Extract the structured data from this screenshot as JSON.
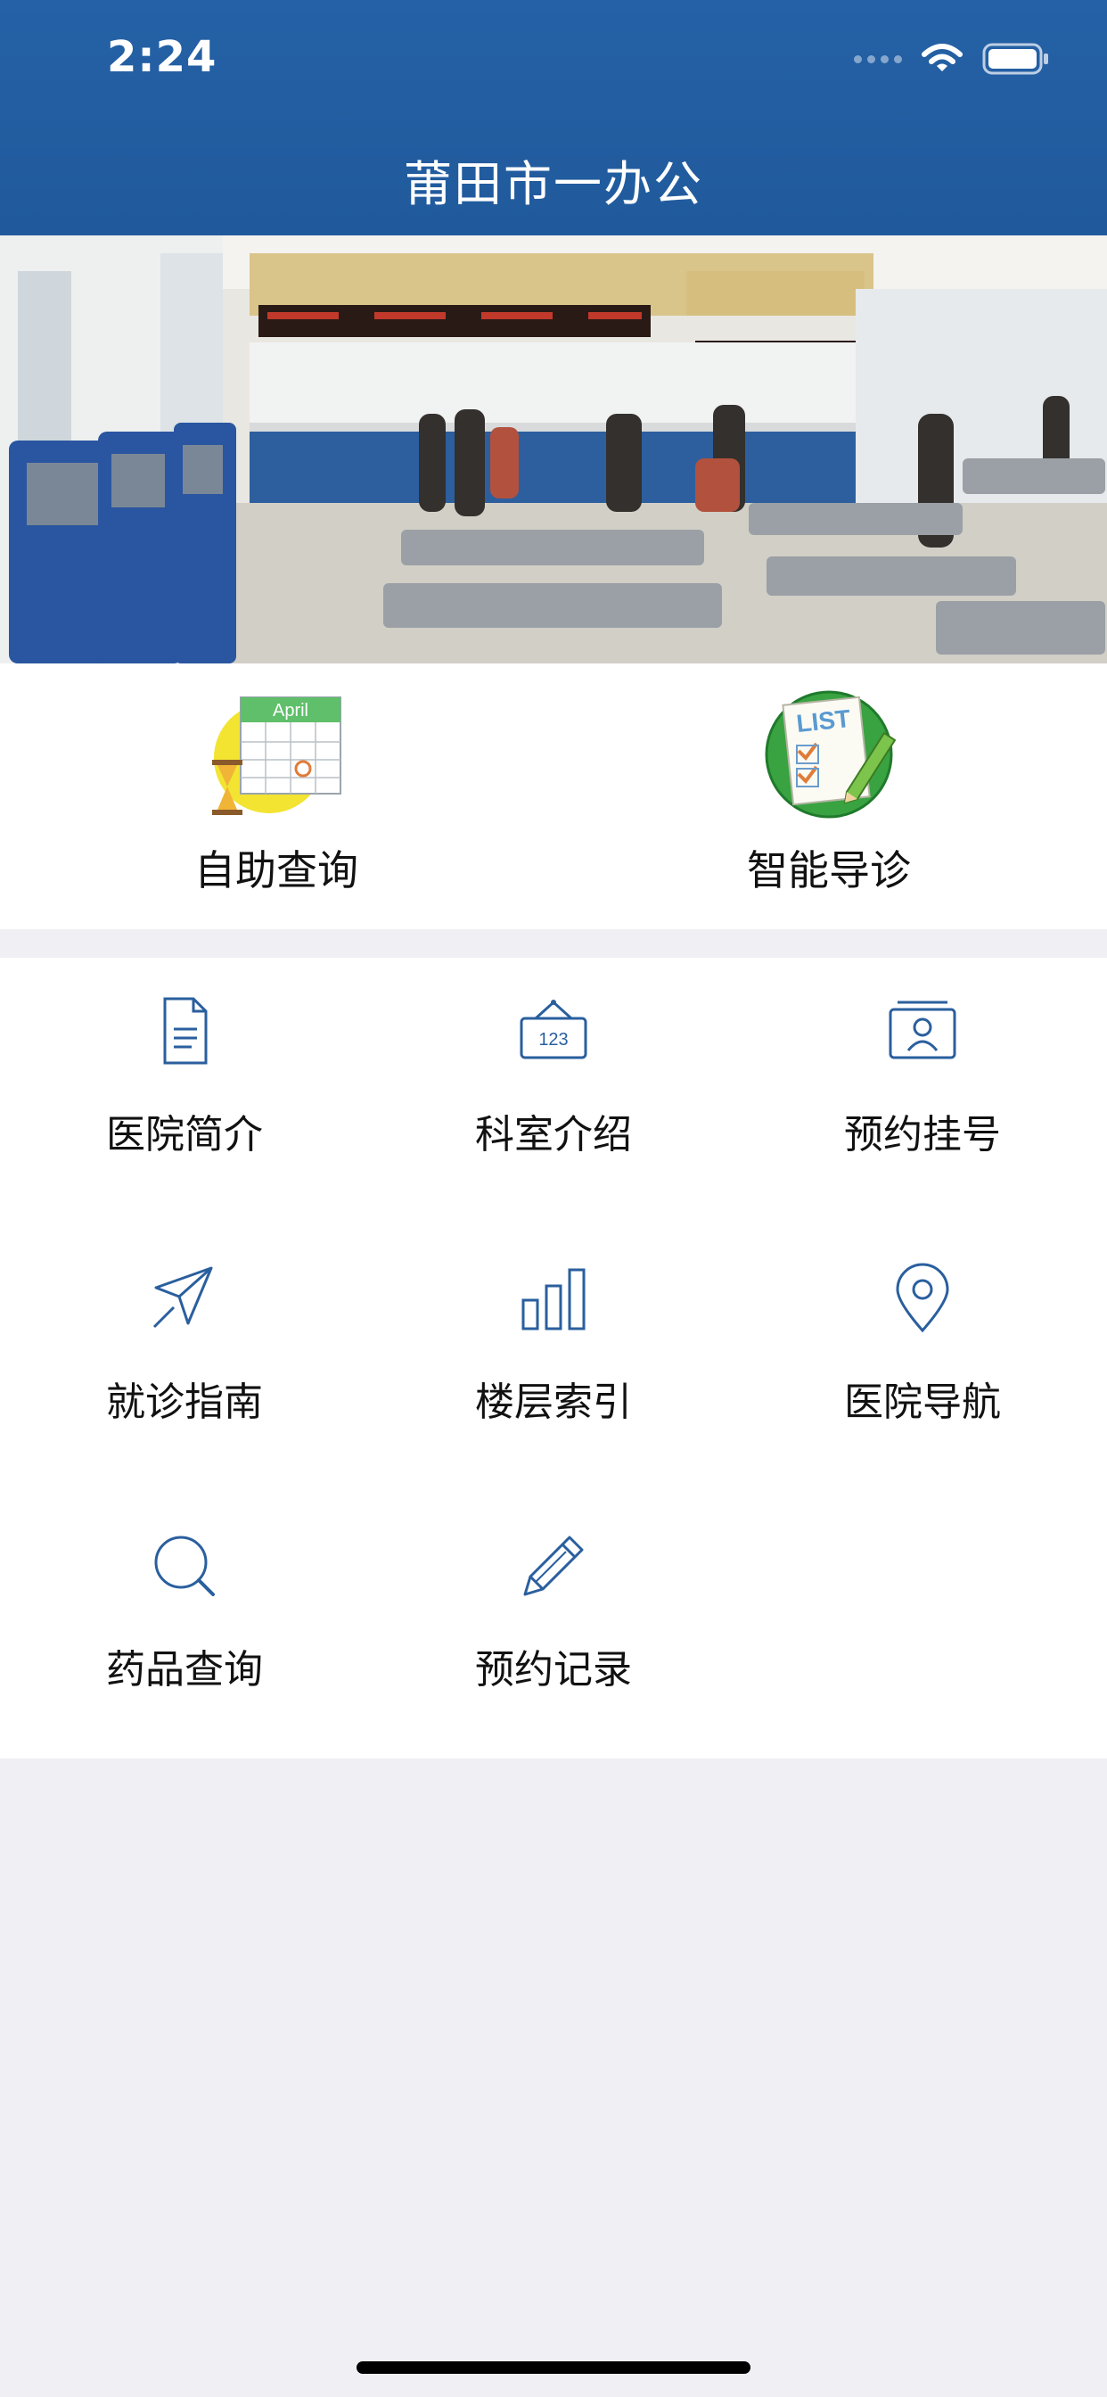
{
  "status_bar": {
    "time": "2:24",
    "wifi_icon": "wifi-icon",
    "battery_icon": "battery-icon"
  },
  "header": {
    "title": "莆田市一办公"
  },
  "banner": {
    "image": "hospital-lobby-photo"
  },
  "quick_actions": [
    {
      "label": "自助查询",
      "icon": "calendar-hourglass-icon",
      "calendar_month": "April"
    },
    {
      "label": "智能导诊",
      "icon": "checklist-icon",
      "badge_text": "LIST"
    }
  ],
  "grid_items": [
    {
      "label": "医院简介",
      "icon": "document-icon"
    },
    {
      "label": "科室介绍",
      "icon": "sign-board-icon",
      "icon_text": "123"
    },
    {
      "label": "预约挂号",
      "icon": "id-card-icon"
    },
    {
      "label": "就诊指南",
      "icon": "paper-plane-icon"
    },
    {
      "label": "楼层索引",
      "icon": "bar-chart-icon"
    },
    {
      "label": "医院导航",
      "icon": "location-pin-icon"
    },
    {
      "label": "药品查询",
      "icon": "search-icon"
    },
    {
      "label": "预约记录",
      "icon": "pencil-icon"
    }
  ],
  "colors": {
    "header_bg": "#2561a6",
    "icon_blue": "#2a5f9e",
    "page_bg": "#efeff4"
  }
}
